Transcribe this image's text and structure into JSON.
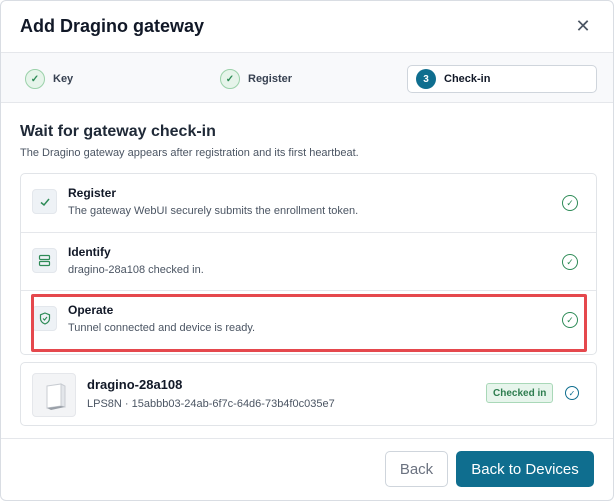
{
  "dialog": {
    "title": "Add Dragino gateway"
  },
  "steps": [
    {
      "number": "",
      "label": "Key"
    },
    {
      "number": "",
      "label": "Register"
    },
    {
      "number": "3",
      "label": "Check-in"
    }
  ],
  "section": {
    "title": "Wait for gateway check-in",
    "subtitle": "The Dragino gateway appears after registration and its first heartbeat."
  },
  "checklist": [
    {
      "title": "Register",
      "desc": "The gateway WebUI securely submits the enrollment token.",
      "icon": "check-icon"
    },
    {
      "title": "Identify",
      "desc": "dragino-28a108 checked in.",
      "icon": "server-icon"
    },
    {
      "title": "Operate",
      "desc": "Tunnel connected and device is ready.",
      "icon": "shield-icon"
    }
  ],
  "device": {
    "name": "dragino-28a108",
    "meta": "LPS8N · 15abbb03-24ab-6f7c-64d6-73b4f0c035e7",
    "status": "Checked in"
  },
  "footer": {
    "back_label": "Back",
    "primary_label": "Back to Devices"
  },
  "colors": {
    "accent": "#0f6e8f",
    "success": "#2e8b57",
    "highlight": "#e5484d"
  }
}
